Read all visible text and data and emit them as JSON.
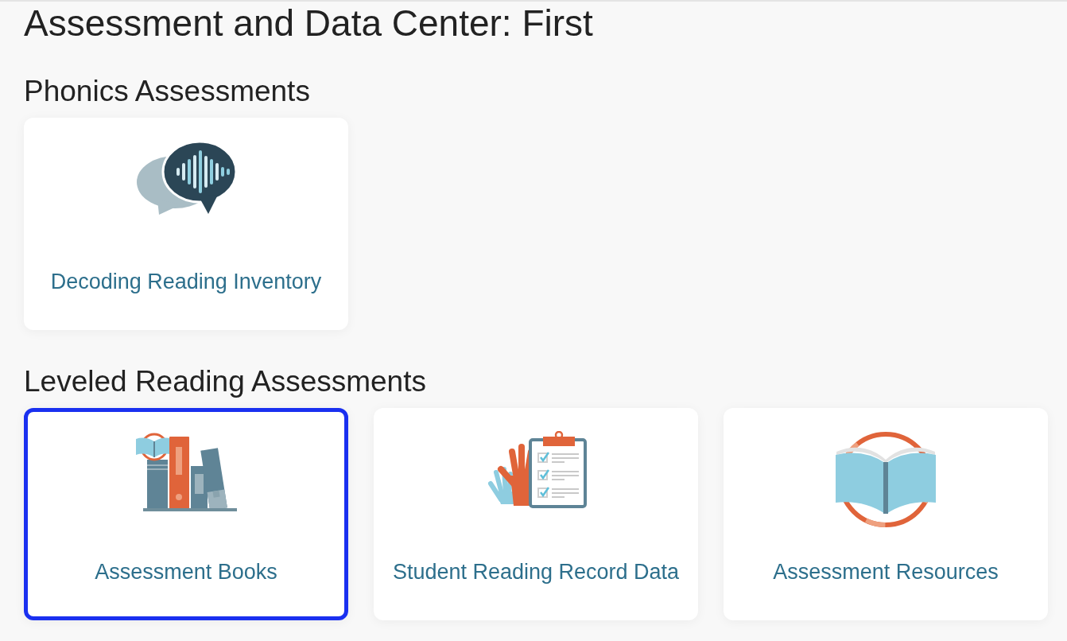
{
  "page": {
    "title": "Assessment and Data Center: First"
  },
  "sections": [
    {
      "heading": "Phonics Assessments",
      "cards": [
        {
          "label": "Decoding Reading Inventory",
          "focused": false
        }
      ]
    },
    {
      "heading": "Leveled Reading Assessments",
      "cards": [
        {
          "label": "Assessment Books",
          "focused": true
        },
        {
          "label": "Student Reading Record Data",
          "focused": false
        },
        {
          "label": "Assessment Resources",
          "focused": false
        }
      ]
    }
  ]
}
